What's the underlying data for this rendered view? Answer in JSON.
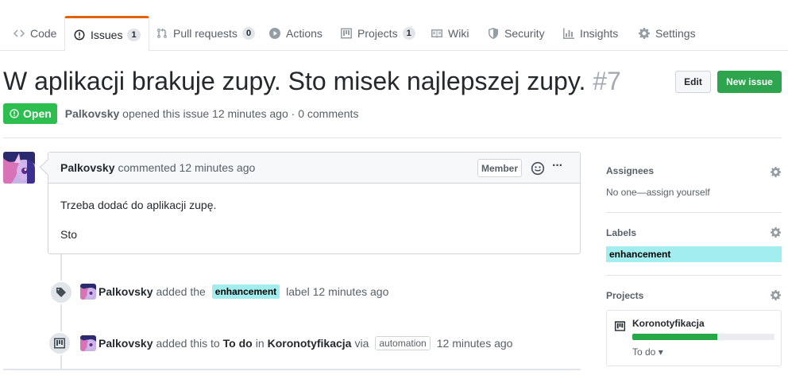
{
  "tabs": [
    {
      "label": "Code",
      "icon": "code-icon"
    },
    {
      "label": "Issues",
      "icon": "issue-icon",
      "count": "1"
    },
    {
      "label": "Pull requests",
      "icon": "pull-request-icon",
      "count": "0"
    },
    {
      "label": "Actions",
      "icon": "play-icon"
    },
    {
      "label": "Projects",
      "icon": "project-icon",
      "count": "1"
    },
    {
      "label": "Wiki",
      "icon": "book-icon"
    },
    {
      "label": "Security",
      "icon": "shield-icon"
    },
    {
      "label": "Insights",
      "icon": "graph-icon"
    },
    {
      "label": "Settings",
      "icon": "gear-icon"
    }
  ],
  "issue": {
    "title": "W aplikacji brakuje zupy. Sto misek najlepszej zupy.",
    "number": "#7",
    "state": "Open",
    "author": "Palkovsky",
    "meta": "opened this issue 12 minutes ago · 0 comments"
  },
  "buttons": {
    "edit": "Edit",
    "new_issue": "New issue"
  },
  "comment": {
    "author": "Palkovsky",
    "meta": "commented 12 minutes ago",
    "badge": "Member",
    "dots": "···",
    "paragraphs": [
      "Trzeba dodać do aplikacji zupę.",
      "Sto"
    ]
  },
  "timeline": {
    "label_event": {
      "actor": "Palkovsky",
      "pre": "added the",
      "label": "enhancement",
      "post": "label 12 minutes ago"
    },
    "project_event": {
      "actor": "Palkovsky",
      "pre": "added this to",
      "column": "To do",
      "mid": "in",
      "project": "Koronotyfikacja",
      "via": "via",
      "bot": "automation",
      "time": "12 minutes ago"
    }
  },
  "sidebar": {
    "assignees": {
      "heading": "Assignees",
      "value": "No one—assign yourself"
    },
    "labels": {
      "heading": "Labels",
      "items": [
        "enhancement"
      ]
    },
    "projects": {
      "heading": "Projects",
      "name": "Koronotyfikacja",
      "progress_percent": 60,
      "column": "To do ▾"
    }
  },
  "colors": {
    "accent_tab": "#e36209",
    "open_state": "#2cbe4e",
    "label_enhancement": "#a2eeef",
    "progress": "#28a745"
  }
}
